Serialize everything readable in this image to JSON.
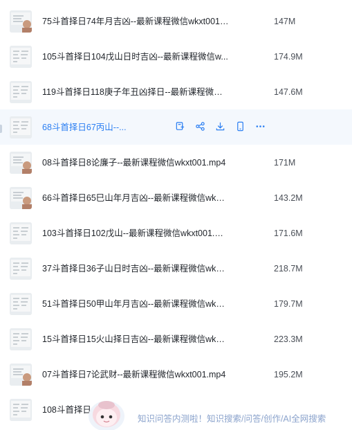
{
  "files": [
    {
      "name": "75斗首择日74年月吉凶--最新课程微信wkxt001....",
      "size": "147M",
      "thumb": "figure"
    },
    {
      "name": "105斗首择日104戊山日时吉凶--最新课程微信w...",
      "size": "174.9M",
      "thumb": "board"
    },
    {
      "name": "119斗首择日118庚子年丑凶择日--最新课程微信...",
      "size": "147.6M",
      "thumb": "board"
    },
    {
      "name": "68斗首择日67丙山--...",
      "size": "",
      "thumb": "board",
      "highlighted": true
    },
    {
      "name": "08斗首择日8论廉子--最新课程微信wkxt001.mp4",
      "size": "171M",
      "thumb": "figure"
    },
    {
      "name": "66斗首择日65巳山年月吉凶--最新课程微信wkxt...",
      "size": "143.2M",
      "thumb": "figure"
    },
    {
      "name": "103斗首择日102戊山--最新课程微信wkxt001.m...",
      "size": "171.6M",
      "thumb": "board"
    },
    {
      "name": "37斗首择日36子山日时吉凶--最新课程微信wkxt...",
      "size": "218.7M",
      "thumb": "board"
    },
    {
      "name": "51斗首择日50甲山年月吉凶--最新课程微信wkxt...",
      "size": "179.7M",
      "thumb": "board"
    },
    {
      "name": "15斗首择日15火山择日吉凶--最新课程微信wkxt...",
      "size": "223.3M",
      "thumb": "board"
    },
    {
      "name": "07斗首择日7论武财--最新课程微信wkxt001.mp4",
      "size": "195.2M",
      "thumb": "figure"
    },
    {
      "name": "108斗首择日",
      "size": "",
      "thumb": "board"
    }
  ],
  "actions": [
    "save-to-cloud-icon",
    "share-icon",
    "download-icon",
    "phone-icon",
    "more-icon"
  ],
  "banner": {
    "text": "知识问答内测啦！知识搜索/问答/创作/AI全网搜索"
  },
  "colors": {
    "accent": "#2a7ef2",
    "highlight_bg": "#f4f8fd",
    "banner_text": "#8ba3cc"
  }
}
